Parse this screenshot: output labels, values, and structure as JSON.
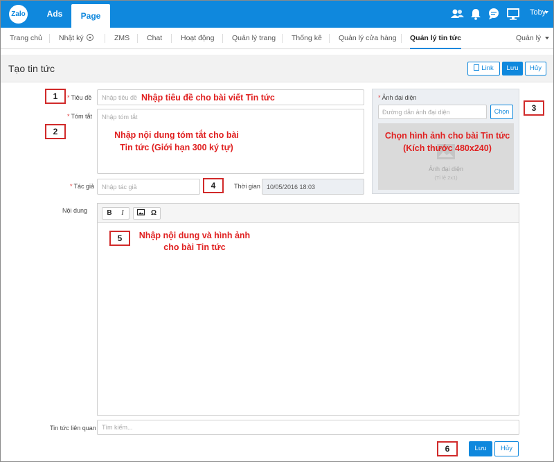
{
  "topbar": {
    "logo": "Zalo",
    "tabs": [
      "Ads",
      "Page"
    ],
    "icons": [
      "users-icon",
      "bell-icon",
      "chat-icon",
      "monitor-icon"
    ],
    "user": "Toby"
  },
  "nav": {
    "items": [
      "Trang chủ",
      "Nhật ký",
      "ZMS",
      "Chat",
      "Hoạt động",
      "Quản lý trang",
      "Thống kê",
      "Quản lý cửa hàng",
      "Quản lý tin tức"
    ],
    "active": "Quản lý tin tức",
    "manage": "Quản lý"
  },
  "header": {
    "title": "Tạo tin tức",
    "link_label": "Link",
    "save_label": "Lưu",
    "cancel_label": "Hủy"
  },
  "form": {
    "title_label": "Tiêu đề",
    "title_placeholder": "Nhập tiêu đề",
    "summary_label": "Tóm tắt",
    "summary_placeholder": "Nhập tóm tắt",
    "author_label": "Tác giả",
    "author_placeholder": "Nhập tác giả",
    "time_label": "Thời gian",
    "time_value": "10/05/2016 18:03",
    "content_label": "Nội dung",
    "related_label": "Tin tức liên quan",
    "related_placeholder": "Tìm kiếm..."
  },
  "image_panel": {
    "label": "Ảnh đại diện",
    "url_placeholder": "Đường dẫn ảnh đại diện",
    "choose_label": "Chọn",
    "placeholder_title": "Ảnh đại diện",
    "placeholder_ratio": "(Tỉ lệ 2x1)"
  },
  "editor_tools": [
    "B",
    "I",
    "image-icon",
    "Ω"
  ],
  "footer": {
    "save_label": "Lưu",
    "cancel_label": "Hủy"
  },
  "annotations": {
    "markers": [
      "1",
      "2",
      "3",
      "4",
      "5",
      "6"
    ],
    "note_title": "Nhập tiêu đề cho bài viết Tin tức",
    "note_summary_1": "Nhập nội dung tóm tắt cho bài",
    "note_summary_2": "Tin tức (Giới hạn 300 ký tự)",
    "note_image_1": "Chọn hình ảnh cho bài Tin tức",
    "note_image_2": "(Kích thước 480x240)",
    "note_content_1": "Nhập nội dung và hình ảnh",
    "note_content_2": "cho bài Tin tức"
  },
  "colors": {
    "brand": "#0f88dd",
    "annotation": "#e02020"
  }
}
